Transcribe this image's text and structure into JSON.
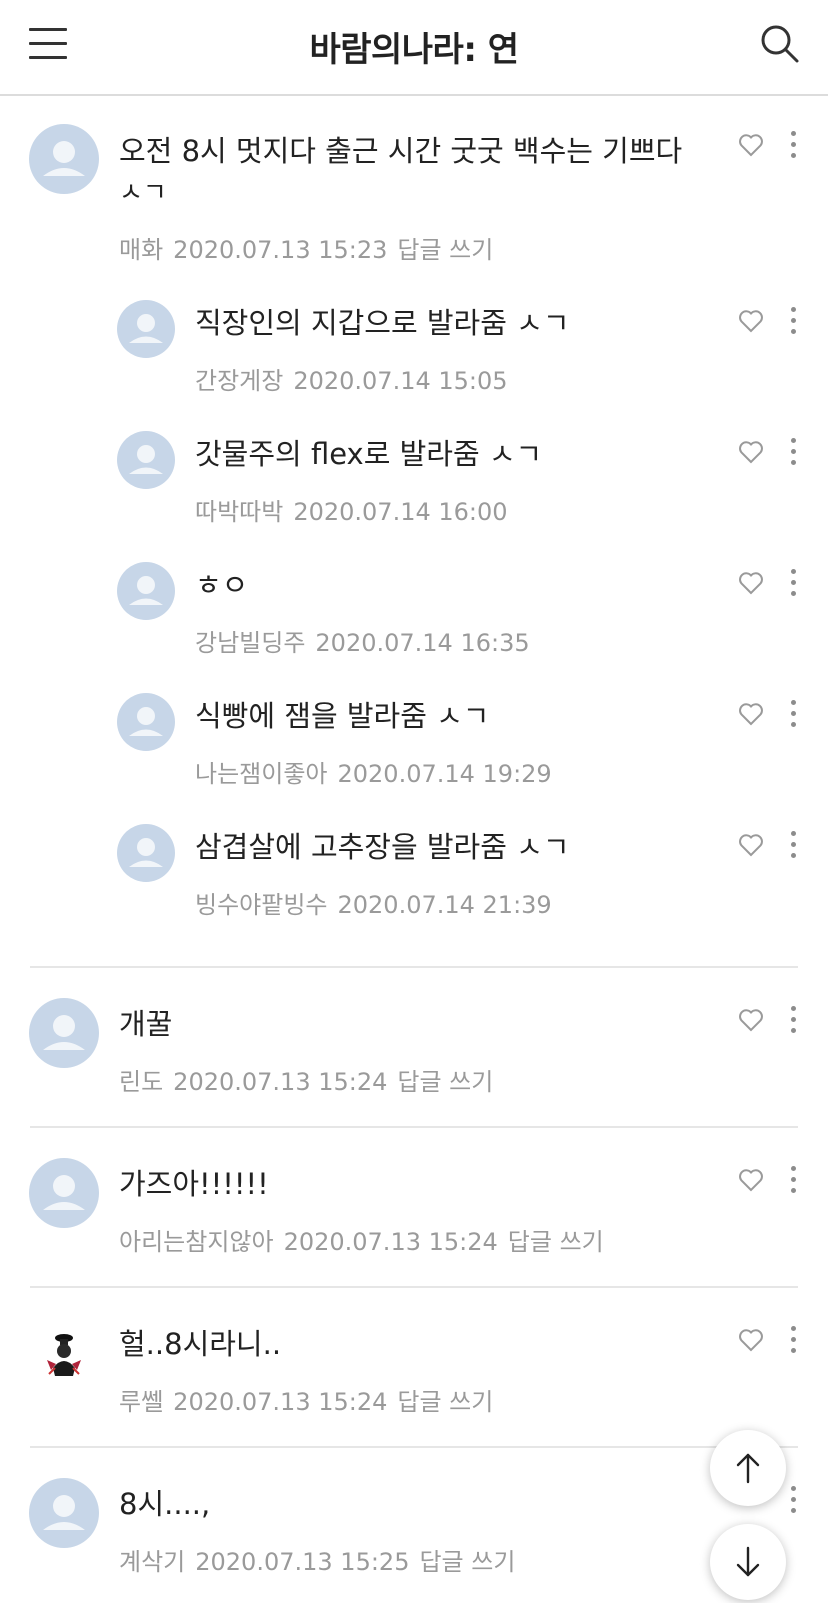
{
  "header": {
    "title": "바람의나라: 연"
  },
  "comments": [
    {
      "text": "오전 8시 멋지다 출근 시간 굿굿 백수는 기쁘다",
      "text2": "ㅅㄱ",
      "author": "매화",
      "date": "2020.07.13 15:23",
      "reply": "답글 쓰기"
    },
    {
      "text": "직장인의 지갑으로 발라줌 ㅅㄱ",
      "author": "간장게장",
      "date": "2020.07.14 15:05"
    },
    {
      "text": "갓물주의 flex로 발라줌 ㅅㄱ",
      "author": "따박따박",
      "date": "2020.07.14 16:00"
    },
    {
      "text": "ㅎㅇ",
      "author": "강남빌딩주",
      "date": "2020.07.14 16:35"
    },
    {
      "text": "식빵에 잼을 발라줌 ㅅㄱ",
      "author": "나는잼이좋아",
      "date": "2020.07.14 19:29"
    },
    {
      "text": "삼겹살에 고추장을 발라줌 ㅅㄱ",
      "author": "빙수야팥빙수",
      "date": "2020.07.14 21:39"
    },
    {
      "text": "개꿀",
      "author": "린도",
      "date": "2020.07.13 15:24",
      "reply": "답글 쓰기"
    },
    {
      "text": "가즈아!!!!!!",
      "author": "아리는참지않아",
      "date": "2020.07.13 15:24",
      "reply": "답글 쓰기"
    },
    {
      "text": "헐..8시라니..",
      "author": "루쎌",
      "date": "2020.07.13 15:24",
      "reply": "답글 쓰기"
    },
    {
      "text": "8시....,",
      "author": "계삭기",
      "date": "2020.07.13 15:25",
      "reply": "답글 쓰기"
    }
  ],
  "icons": {
    "menu": "hamburger-icon",
    "search": "search-icon",
    "like": "heart-icon",
    "more": "more-vertical-icon",
    "scroll_up": "arrow-up-icon",
    "scroll_down": "arrow-down-icon"
  },
  "colors": {
    "avatar": "#c7d6e8",
    "meta": "#9a9a9a",
    "divider": "#e6e6e6"
  }
}
